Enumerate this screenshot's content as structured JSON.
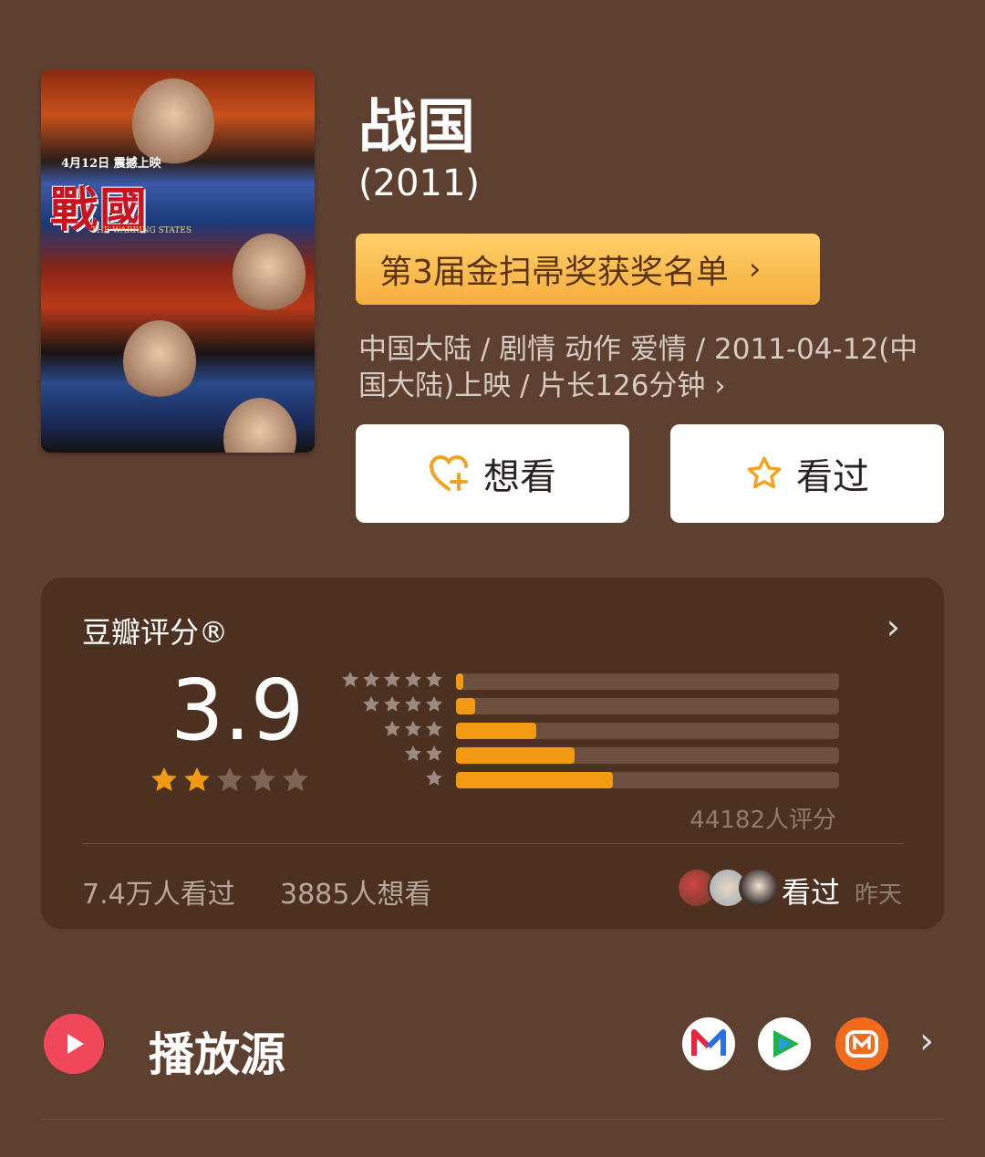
{
  "movie": {
    "title": "战国",
    "year": "(2011)",
    "award_label": "第3届金扫帚奖获奖名单",
    "meta_line1": "中国大陆 / 剧情 动作 爱情 / 2011-04-12(中",
    "meta_line2": "国大陆)上映 / 片长126分钟 ›",
    "poster": {
      "title_text": "戰國",
      "date_text": "4月12日 震撼上映",
      "subtitle_text": "THE WARRING STATES"
    }
  },
  "actions": {
    "want_label": "想看",
    "seen_label": "看过"
  },
  "rating": {
    "title": "豆瓣评分®",
    "score": "3.9",
    "stars_filled": 2,
    "stars_total": 5,
    "votes_label": "44182人评分",
    "distribution": [
      {
        "stars": 5,
        "fraction": 0.02
      },
      {
        "stars": 4,
        "fraction": 0.05
      },
      {
        "stars": 3,
        "fraction": 0.21
      },
      {
        "stars": 2,
        "fraction": 0.31
      },
      {
        "stars": 1,
        "fraction": 0.41
      }
    ],
    "seen_count": "7.4万人看过",
    "want_count": "3885人想看",
    "friend_label": "看过",
    "friend_time": "昨天"
  },
  "sources": {
    "label": "播放源",
    "icons": [
      "mgtv-app-icon",
      "tencent-video-icon",
      "mango-tv-icon"
    ]
  },
  "colors": {
    "background": "#5e4030",
    "card": "#4c3121",
    "accent_orange": "#f39a14",
    "award_gold": "#f6ae3c",
    "play_red": "#f0485a"
  }
}
